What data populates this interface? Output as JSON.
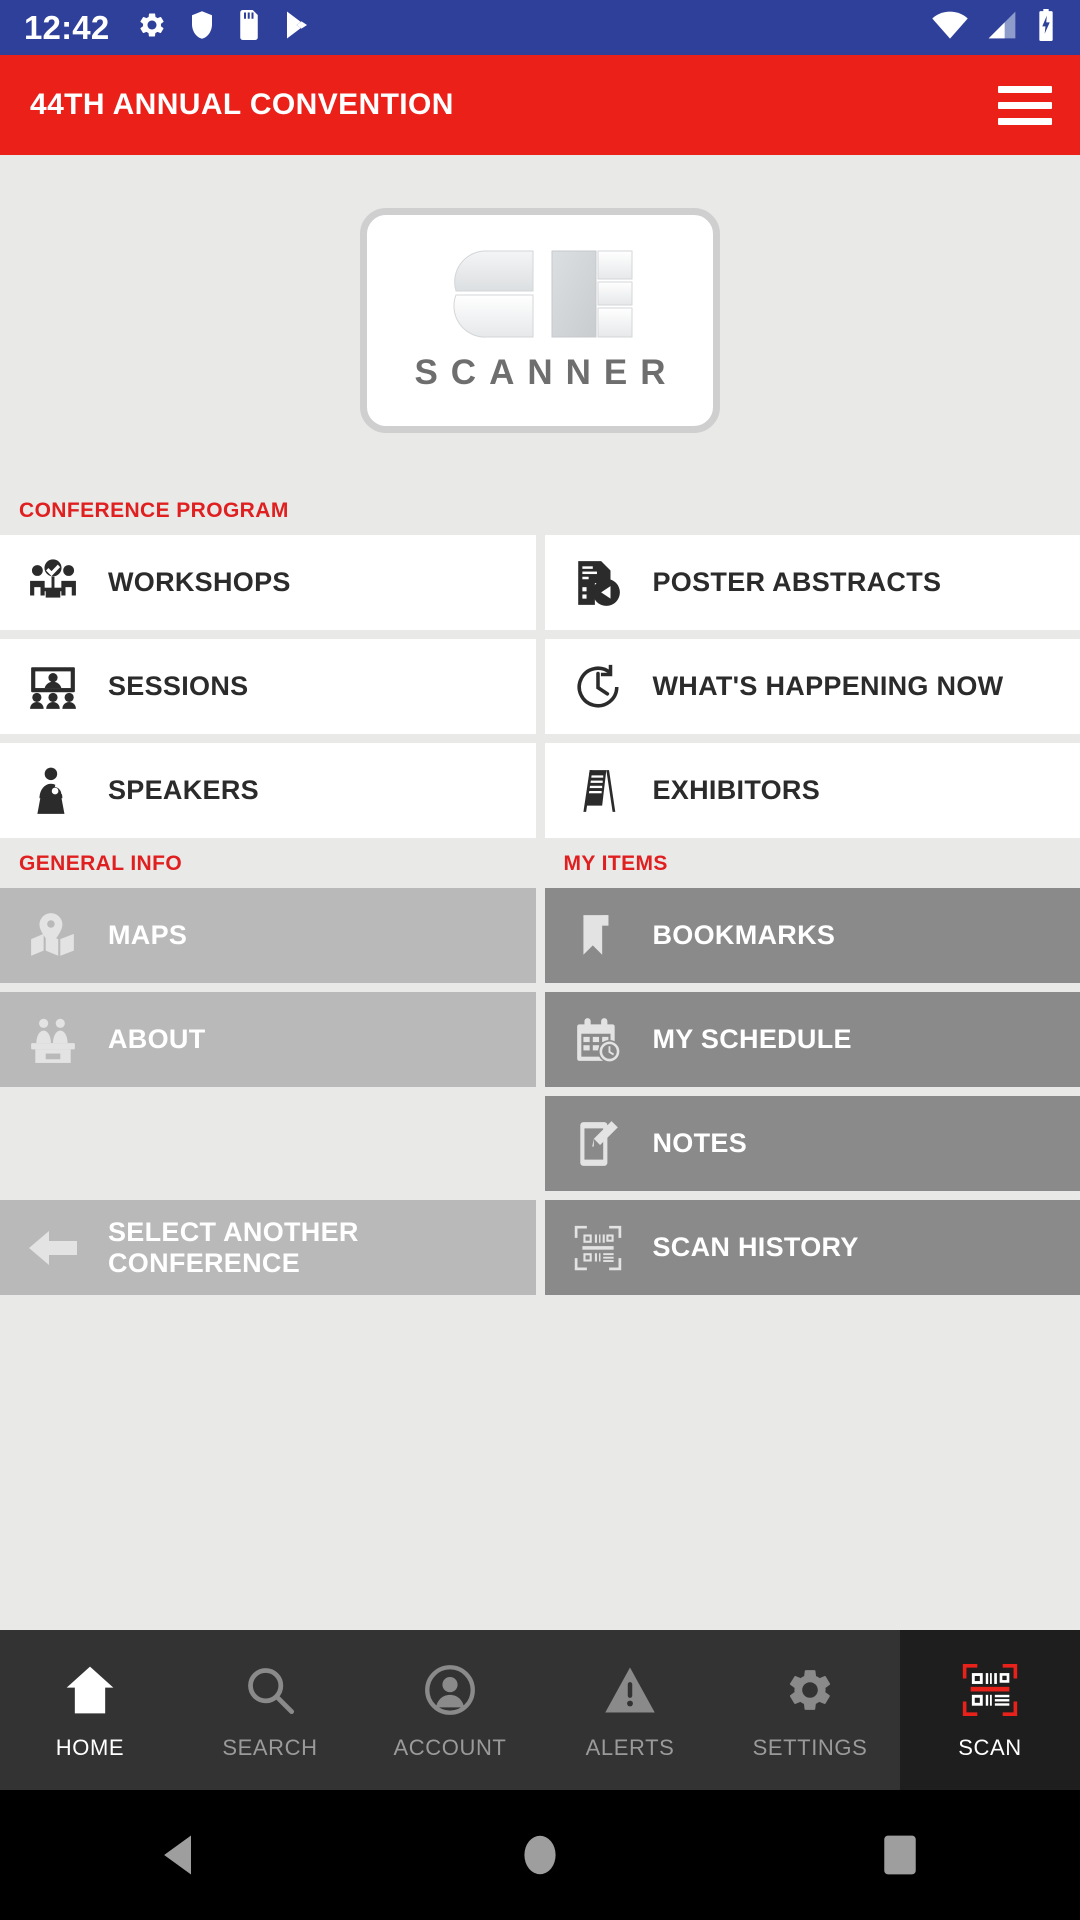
{
  "status_bar": {
    "time": "12:42",
    "left_icons": [
      "gear-icon",
      "shield-icon",
      "sd-card-icon",
      "play-store-icon"
    ],
    "right_icons": [
      "wifi-icon",
      "cell-signal-icon",
      "battery-charging-icon"
    ],
    "background": "#2f409b"
  },
  "app_bar": {
    "title": "44TH ANNUAL CONVENTION",
    "menu_icon": "hamburger-menu-icon",
    "background": "#ea2019"
  },
  "logo": {
    "wordmark": "SCANNER",
    "mark_alt": "CE monogram"
  },
  "colors": {
    "accent_red": "#e02020",
    "header_red": "#ea2019",
    "tile_white": "#ffffff",
    "tile_gray_light": "#b9b9b9",
    "tile_gray_dark": "#8a8a8a",
    "page_background": "#e9e9e7",
    "tabbar": "#333333",
    "tabbar_scan": "#1e1e1e"
  },
  "sections": {
    "conference_program": {
      "label": "CONFERENCE PROGRAM",
      "left_items": [
        {
          "label": "WORKSHOPS",
          "icon": "workshops-icon",
          "style": "white"
        },
        {
          "label": "SESSIONS",
          "icon": "sessions-icon",
          "style": "white"
        },
        {
          "label": "SPEAKERS",
          "icon": "speakers-icon",
          "style": "white"
        }
      ],
      "right_items": [
        {
          "label": "POSTER ABSTRACTS",
          "icon": "poster-abstracts-icon",
          "style": "white"
        },
        {
          "label": "WHAT'S HAPPENING NOW",
          "icon": "clock-icon",
          "style": "white"
        },
        {
          "label": "EXHIBITORS",
          "icon": "exhibitors-icon",
          "style": "white"
        }
      ]
    },
    "general_info": {
      "label": "GENERAL INFO",
      "items": [
        {
          "label": "MAPS",
          "icon": "map-pin-icon",
          "style": "gray-l"
        },
        {
          "label": "ABOUT",
          "icon": "info-desk-icon",
          "style": "gray-l"
        },
        {
          "label": "SELECT ANOTHER CONFERENCE",
          "icon": "back-arrow-icon",
          "style": "gray-l"
        }
      ]
    },
    "my_items": {
      "label": "MY ITEMS",
      "items": [
        {
          "label": "BOOKMARKS",
          "icon": "bookmark-icon",
          "style": "gray-d"
        },
        {
          "label": "MY SCHEDULE",
          "icon": "calendar-clock-icon",
          "style": "gray-d"
        },
        {
          "label": "NOTES",
          "icon": "notes-pencil-icon",
          "style": "gray-d"
        },
        {
          "label": "SCAN HISTORY",
          "icon": "qr-scan-icon",
          "style": "gray-d"
        }
      ]
    }
  },
  "tab_bar": {
    "tabs": [
      {
        "label": "HOME",
        "icon": "home-icon",
        "active": true
      },
      {
        "label": "SEARCH",
        "icon": "search-icon",
        "active": false
      },
      {
        "label": "ACCOUNT",
        "icon": "account-icon",
        "active": false
      },
      {
        "label": "ALERTS",
        "icon": "alert-triangle-icon",
        "active": false
      },
      {
        "label": "SETTINGS",
        "icon": "gear-icon",
        "active": false
      },
      {
        "label": "SCAN",
        "icon": "qr-scan-icon",
        "active": false
      }
    ]
  },
  "android_nav": {
    "buttons": [
      "back-icon",
      "home-circle-icon",
      "recents-square-icon"
    ]
  }
}
